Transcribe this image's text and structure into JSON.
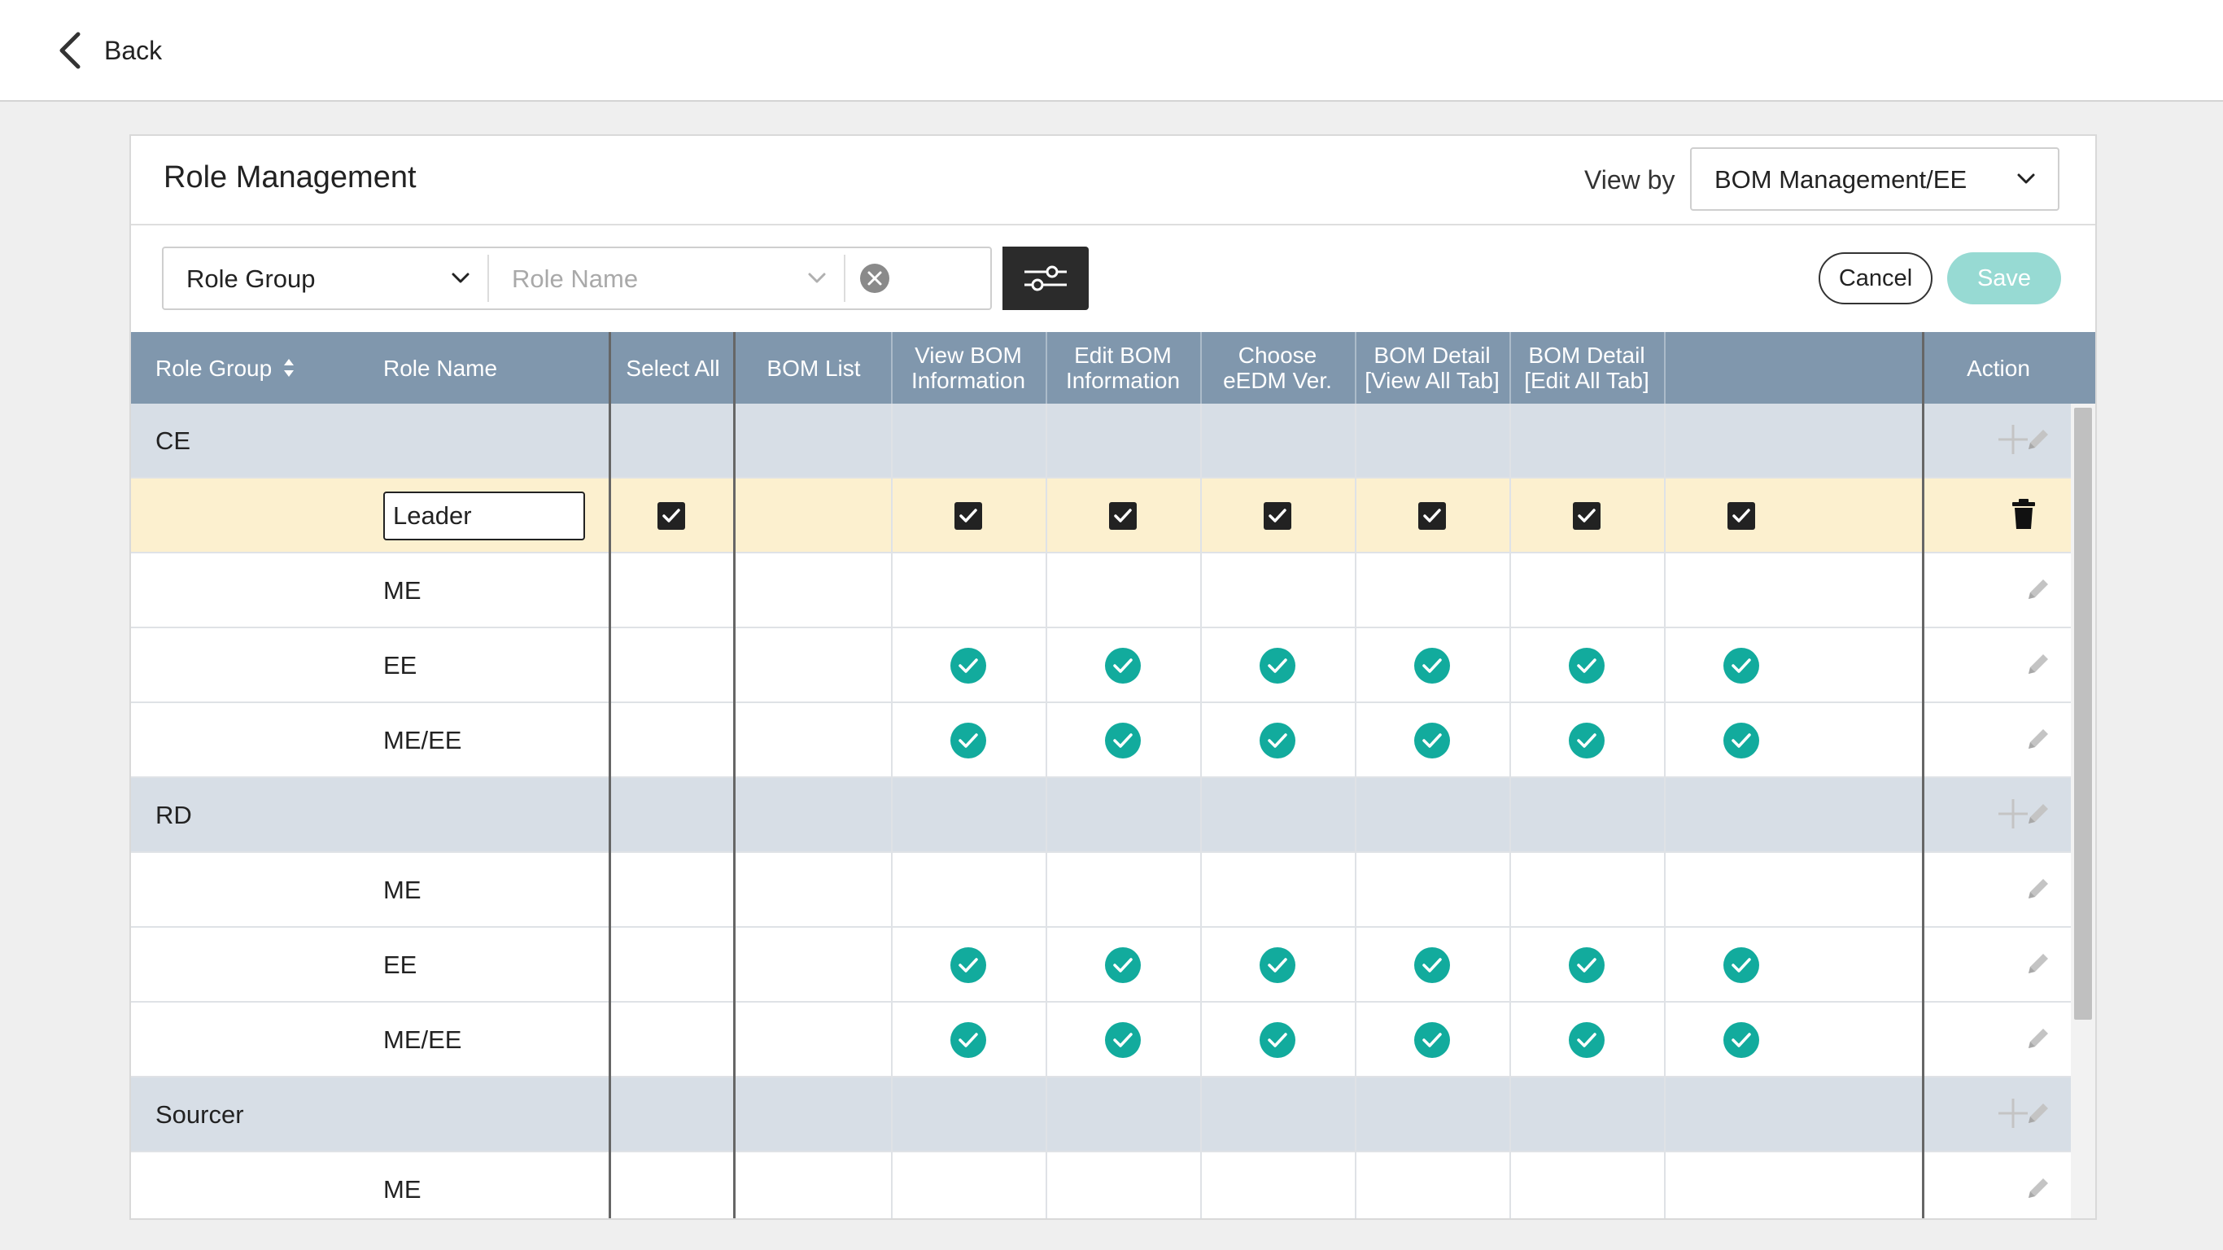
{
  "topbar": {
    "back_label": "Back"
  },
  "header": {
    "title": "Role Management",
    "view_by_label": "View by",
    "view_by_value": "BOM Management/EE"
  },
  "toolbar": {
    "role_group_value": "Role Group",
    "role_name_placeholder": "Role Name",
    "cancel_label": "Cancel",
    "save_label": "Save"
  },
  "columns": {
    "role_group": "Role Group",
    "role_name": "Role Name",
    "select_all": "Select All",
    "bom_list": "BOM List",
    "view_bom_info": [
      "View BOM",
      "Information"
    ],
    "edit_bom_info": [
      "Edit BOM",
      "Information"
    ],
    "choose_eedm": [
      "Choose",
      "eEDM Ver."
    ],
    "bom_detail_view": [
      "BOM Detail",
      "[View All Tab]"
    ],
    "bom_detail_edit": [
      "BOM Detail",
      "[Edit All Tab]"
    ],
    "action": "Action"
  },
  "rows": [
    {
      "type": "group",
      "label": "CE"
    },
    {
      "type": "edit",
      "role": "Leader",
      "select_all": true,
      "perms": [
        true,
        true,
        true,
        true,
        true,
        true
      ]
    },
    {
      "type": "role",
      "role": "ME",
      "perms": [
        false,
        false,
        false,
        false,
        false,
        false
      ]
    },
    {
      "type": "role",
      "role": "EE",
      "perms": [
        true,
        true,
        true,
        true,
        true,
        true
      ]
    },
    {
      "type": "role",
      "role": "ME/EE",
      "perms": [
        true,
        true,
        true,
        true,
        true,
        true
      ]
    },
    {
      "type": "group",
      "label": "RD"
    },
    {
      "type": "role",
      "role": "ME",
      "perms": [
        false,
        false,
        false,
        false,
        false,
        false
      ]
    },
    {
      "type": "role",
      "role": "EE",
      "perms": [
        true,
        true,
        true,
        true,
        true,
        true
      ]
    },
    {
      "type": "role",
      "role": "ME/EE",
      "perms": [
        true,
        true,
        true,
        true,
        true,
        true
      ]
    },
    {
      "type": "group",
      "label": "Sourcer"
    },
    {
      "type": "role",
      "role": "ME",
      "perms": [
        false,
        false,
        false,
        false,
        false,
        false
      ]
    }
  ],
  "colors": {
    "header_bg": "#8097ad",
    "group_bg": "#d7dee6",
    "edit_bg": "#fcf0cf",
    "check_teal": "#12ab9d",
    "save_disabled": "#97dad3"
  },
  "icons": {
    "back": "chevron-left-icon",
    "dropdown": "chevron-down-icon",
    "clear": "close-circle-icon",
    "filter": "sliders-icon",
    "sort": "sort-icon",
    "granted": "check-circle-icon",
    "checkbox": "checkbox-checked-icon",
    "add": "plus-icon",
    "edit": "pencil-icon",
    "delete": "trash-icon"
  }
}
